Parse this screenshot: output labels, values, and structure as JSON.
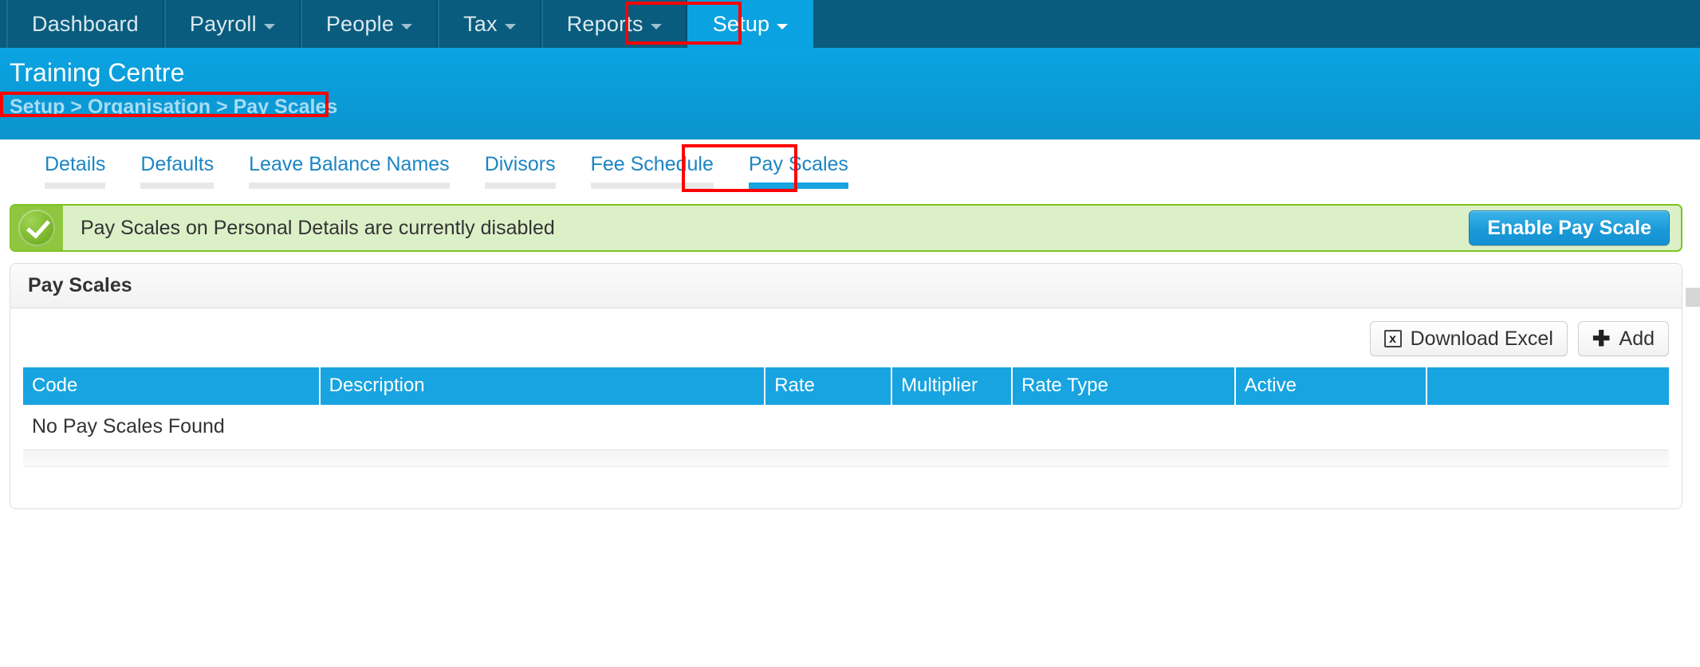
{
  "navbar": {
    "items": [
      {
        "label": "Dashboard",
        "has_caret": false,
        "active": false
      },
      {
        "label": "Payroll",
        "has_caret": true,
        "active": false
      },
      {
        "label": "People",
        "has_caret": true,
        "active": false
      },
      {
        "label": "Tax",
        "has_caret": true,
        "active": false
      },
      {
        "label": "Reports",
        "has_caret": true,
        "active": false
      },
      {
        "label": "Setup",
        "has_caret": true,
        "active": true
      }
    ]
  },
  "header": {
    "org_title": "Training Centre",
    "breadcrumb": "Setup > Organisation > Pay Scales"
  },
  "tabs": [
    {
      "label": "Details",
      "active": false
    },
    {
      "label": "Defaults",
      "active": false
    },
    {
      "label": "Leave Balance Names",
      "active": false
    },
    {
      "label": "Divisors",
      "active": false
    },
    {
      "label": "Fee Schedule",
      "active": false
    },
    {
      "label": "Pay Scales",
      "active": true
    }
  ],
  "alert": {
    "icon": "check-circle-icon",
    "message": "Pay Scales on Personal Details are currently disabled",
    "button_label": "Enable Pay Scale"
  },
  "panel": {
    "title": "Pay Scales",
    "toolbar": {
      "download_label": "Download Excel",
      "download_icon": "excel-icon",
      "add_label": "Add",
      "add_icon": "plus-icon"
    },
    "table": {
      "columns": [
        "Code",
        "Description",
        "Rate",
        "Multiplier",
        "Rate Type",
        "Active",
        ""
      ],
      "rows": [],
      "empty_message": "No Pay Scales Found"
    }
  },
  "colors": {
    "nav_background": "#0a5c7e",
    "nav_active": "#0aa2e0",
    "header_background": "#0aa4e2",
    "breadcrumb_text": "#a8dcf4",
    "tab_link": "#1b85c4",
    "tab_active_underline": "#17a4e0",
    "alert_background": "#dcf0c8",
    "alert_border": "#7fc320",
    "alert_icon_panel": "#8ec63f",
    "primary_button": "#1b9ad9",
    "table_header": "#17a4e0",
    "annotation_box": "#fe0000"
  }
}
